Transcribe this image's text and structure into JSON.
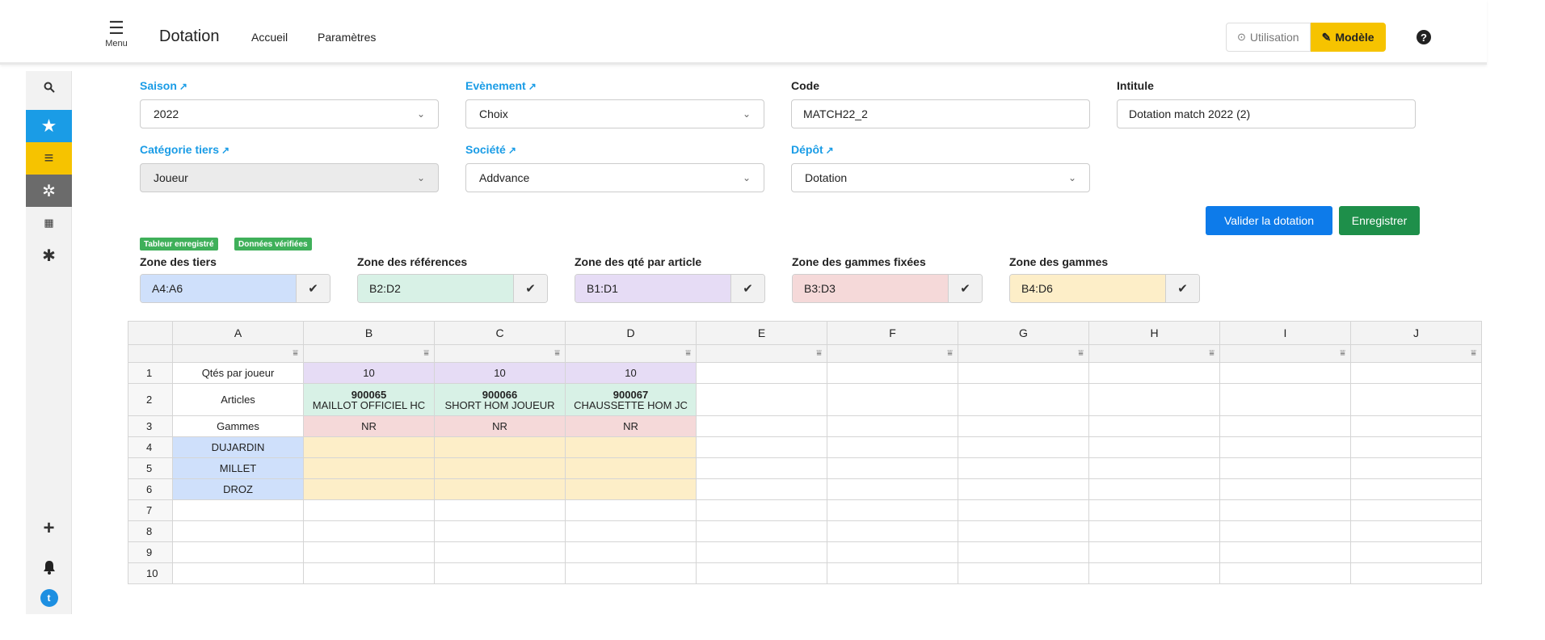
{
  "header": {
    "menu_label": "Menu",
    "title": "Dotation",
    "nav": [
      "Accueil",
      "Paramètres"
    ],
    "mode_usage": "Utilisation",
    "mode_model": "Modèle",
    "accent_color": "#f6c300"
  },
  "rail": {
    "icons": [
      "search-icon",
      "star-icon",
      "bars-icon",
      "gear-icon",
      "grid-icon",
      "asterisk-icon",
      "plus-icon",
      "bell-icon",
      "twitter-icon"
    ]
  },
  "form": {
    "saison": {
      "label": "Saison",
      "value": "2022"
    },
    "evenement": {
      "label": "Evènement",
      "value": "Choix"
    },
    "code": {
      "label": "Code",
      "value": "MATCH22_2"
    },
    "intitule": {
      "label": "Intitule",
      "value": "Dotation match 2022 (2)"
    },
    "categorie": {
      "label": "Catégorie tiers",
      "value": "Joueur"
    },
    "societe": {
      "label": "Société",
      "value": "Addvance"
    },
    "depot": {
      "label": "Dépôt",
      "value": "Dotation"
    }
  },
  "actions": {
    "validate": "Valider la dotation",
    "save": "Enregistrer"
  },
  "badges": [
    "Tableur enregistré",
    "Données vérifiées"
  ],
  "zones": [
    {
      "label": "Zone des tiers",
      "value": "A4:A6",
      "color": "#cfe0fb"
    },
    {
      "label": "Zone des références",
      "value": "B2:D2",
      "color": "#d8f1e6"
    },
    {
      "label": "Zone des qté par article",
      "value": "B1:D1",
      "color": "#e6dcf5"
    },
    {
      "label": "Zone des gammes fixées",
      "value": "B3:D3",
      "color": "#f5d9d9"
    },
    {
      "label": "Zone des gammes",
      "value": "B4:D6",
      "color": "#fdeec8"
    }
  ],
  "sheet": {
    "columns": [
      "A",
      "B",
      "C",
      "D",
      "E",
      "F",
      "G",
      "H",
      "I",
      "J"
    ],
    "rows": [
      {
        "num": "1",
        "a": "Qtés par joueur",
        "b": "10",
        "c": "10",
        "d": "10"
      },
      {
        "num": "2",
        "a": "Articles",
        "b": {
          "code": "900065",
          "name": "MAILLOT OFFICIEL HC"
        },
        "c": {
          "code": "900066",
          "name": "SHORT HOM JOUEUR"
        },
        "d": {
          "code": "900067",
          "name": "CHAUSSETTE HOM JC"
        }
      },
      {
        "num": "3",
        "a": "Gammes",
        "b": "NR",
        "c": "NR",
        "d": "NR"
      },
      {
        "num": "4",
        "a": "DUJARDIN",
        "b": "",
        "c": "",
        "d": ""
      },
      {
        "num": "5",
        "a": "MILLET",
        "b": "",
        "c": "",
        "d": ""
      },
      {
        "num": "6",
        "a": "DROZ",
        "b": "",
        "c": "",
        "d": ""
      },
      {
        "num": "7",
        "a": "",
        "b": "",
        "c": "",
        "d": ""
      },
      {
        "num": "8",
        "a": "",
        "b": "",
        "c": "",
        "d": ""
      },
      {
        "num": "9",
        "a": "",
        "b": "",
        "c": "",
        "d": ""
      },
      {
        "num": "10",
        "a": "",
        "b": "",
        "c": "",
        "d": ""
      }
    ]
  }
}
